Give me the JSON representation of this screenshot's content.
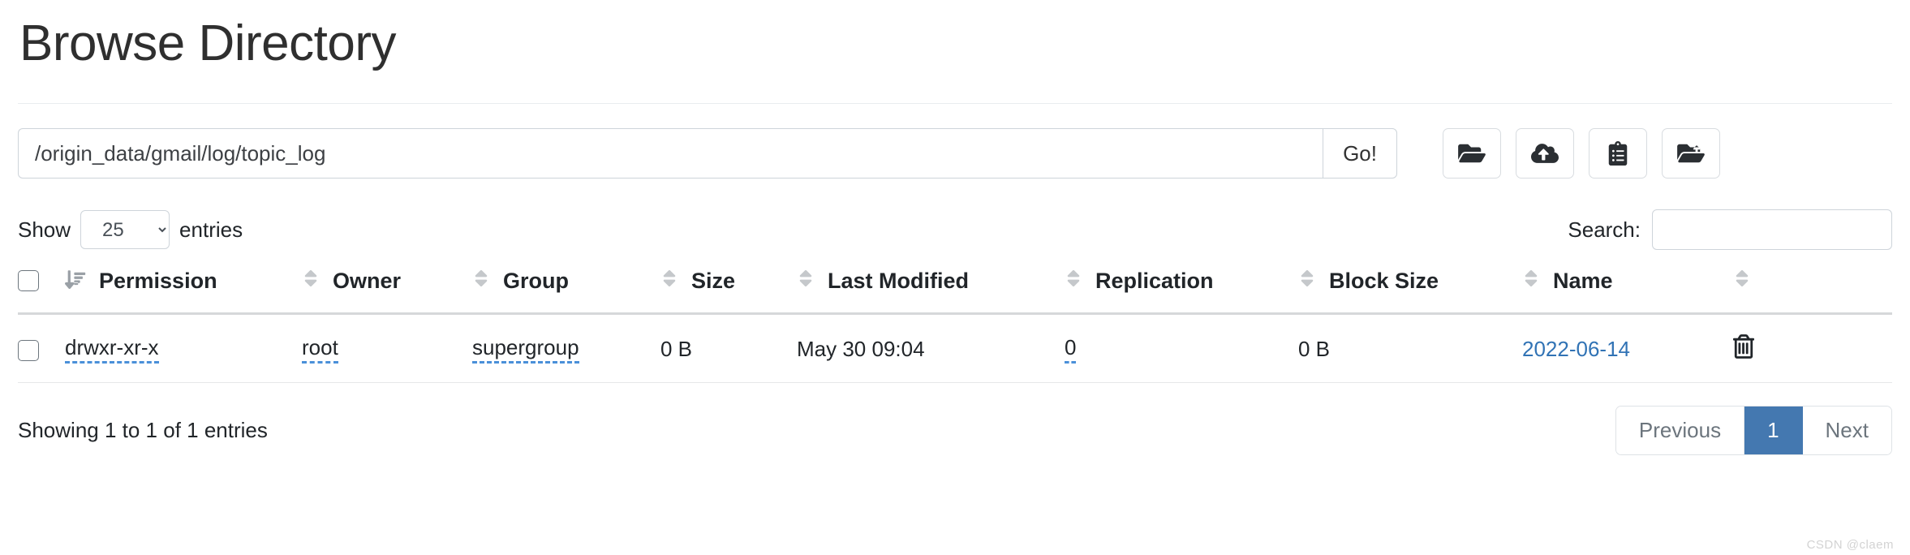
{
  "header": {
    "title": "Browse Directory"
  },
  "path_bar": {
    "value": "/origin_data/gmail/log/topic_log",
    "placeholder": "",
    "go_label": "Go!",
    "tools": [
      {
        "name": "create-directory-icon",
        "title": "Create Directory"
      },
      {
        "name": "cloud-upload-icon",
        "title": "Upload Files"
      },
      {
        "name": "clipboard-list-icon",
        "title": "Show Clipboard"
      },
      {
        "name": "folder-move-icon",
        "title": "Cut / Paste"
      }
    ]
  },
  "controls": {
    "show_label": "Show",
    "entries_label": "entries",
    "entries_value": "25",
    "entries_options": [
      "25"
    ],
    "search_label": "Search:",
    "search_value": "",
    "search_placeholder": ""
  },
  "table": {
    "columns": [
      {
        "key": "permission",
        "label": "Permission"
      },
      {
        "key": "owner",
        "label": "Owner"
      },
      {
        "key": "group",
        "label": "Group"
      },
      {
        "key": "size",
        "label": "Size"
      },
      {
        "key": "last_modified",
        "label": "Last Modified"
      },
      {
        "key": "replication",
        "label": "Replication"
      },
      {
        "key": "block_size",
        "label": "Block Size"
      },
      {
        "key": "name",
        "label": "Name"
      }
    ],
    "rows": [
      {
        "permission": "drwxr-xr-x",
        "owner": "root",
        "group": "supergroup",
        "size": "0 B",
        "last_modified": "May 30 09:04",
        "replication": "0",
        "block_size": "0 B",
        "name": "2022-06-14"
      }
    ]
  },
  "footer": {
    "info": "Showing 1 to 1 of 1 entries",
    "previous_label": "Previous",
    "page_label": "1",
    "next_label": "Next"
  },
  "watermark": "CSDN @claem",
  "colors": {
    "accent": "#4478b0",
    "link": "#3173b5",
    "editable_underline": "#4a90d9"
  }
}
